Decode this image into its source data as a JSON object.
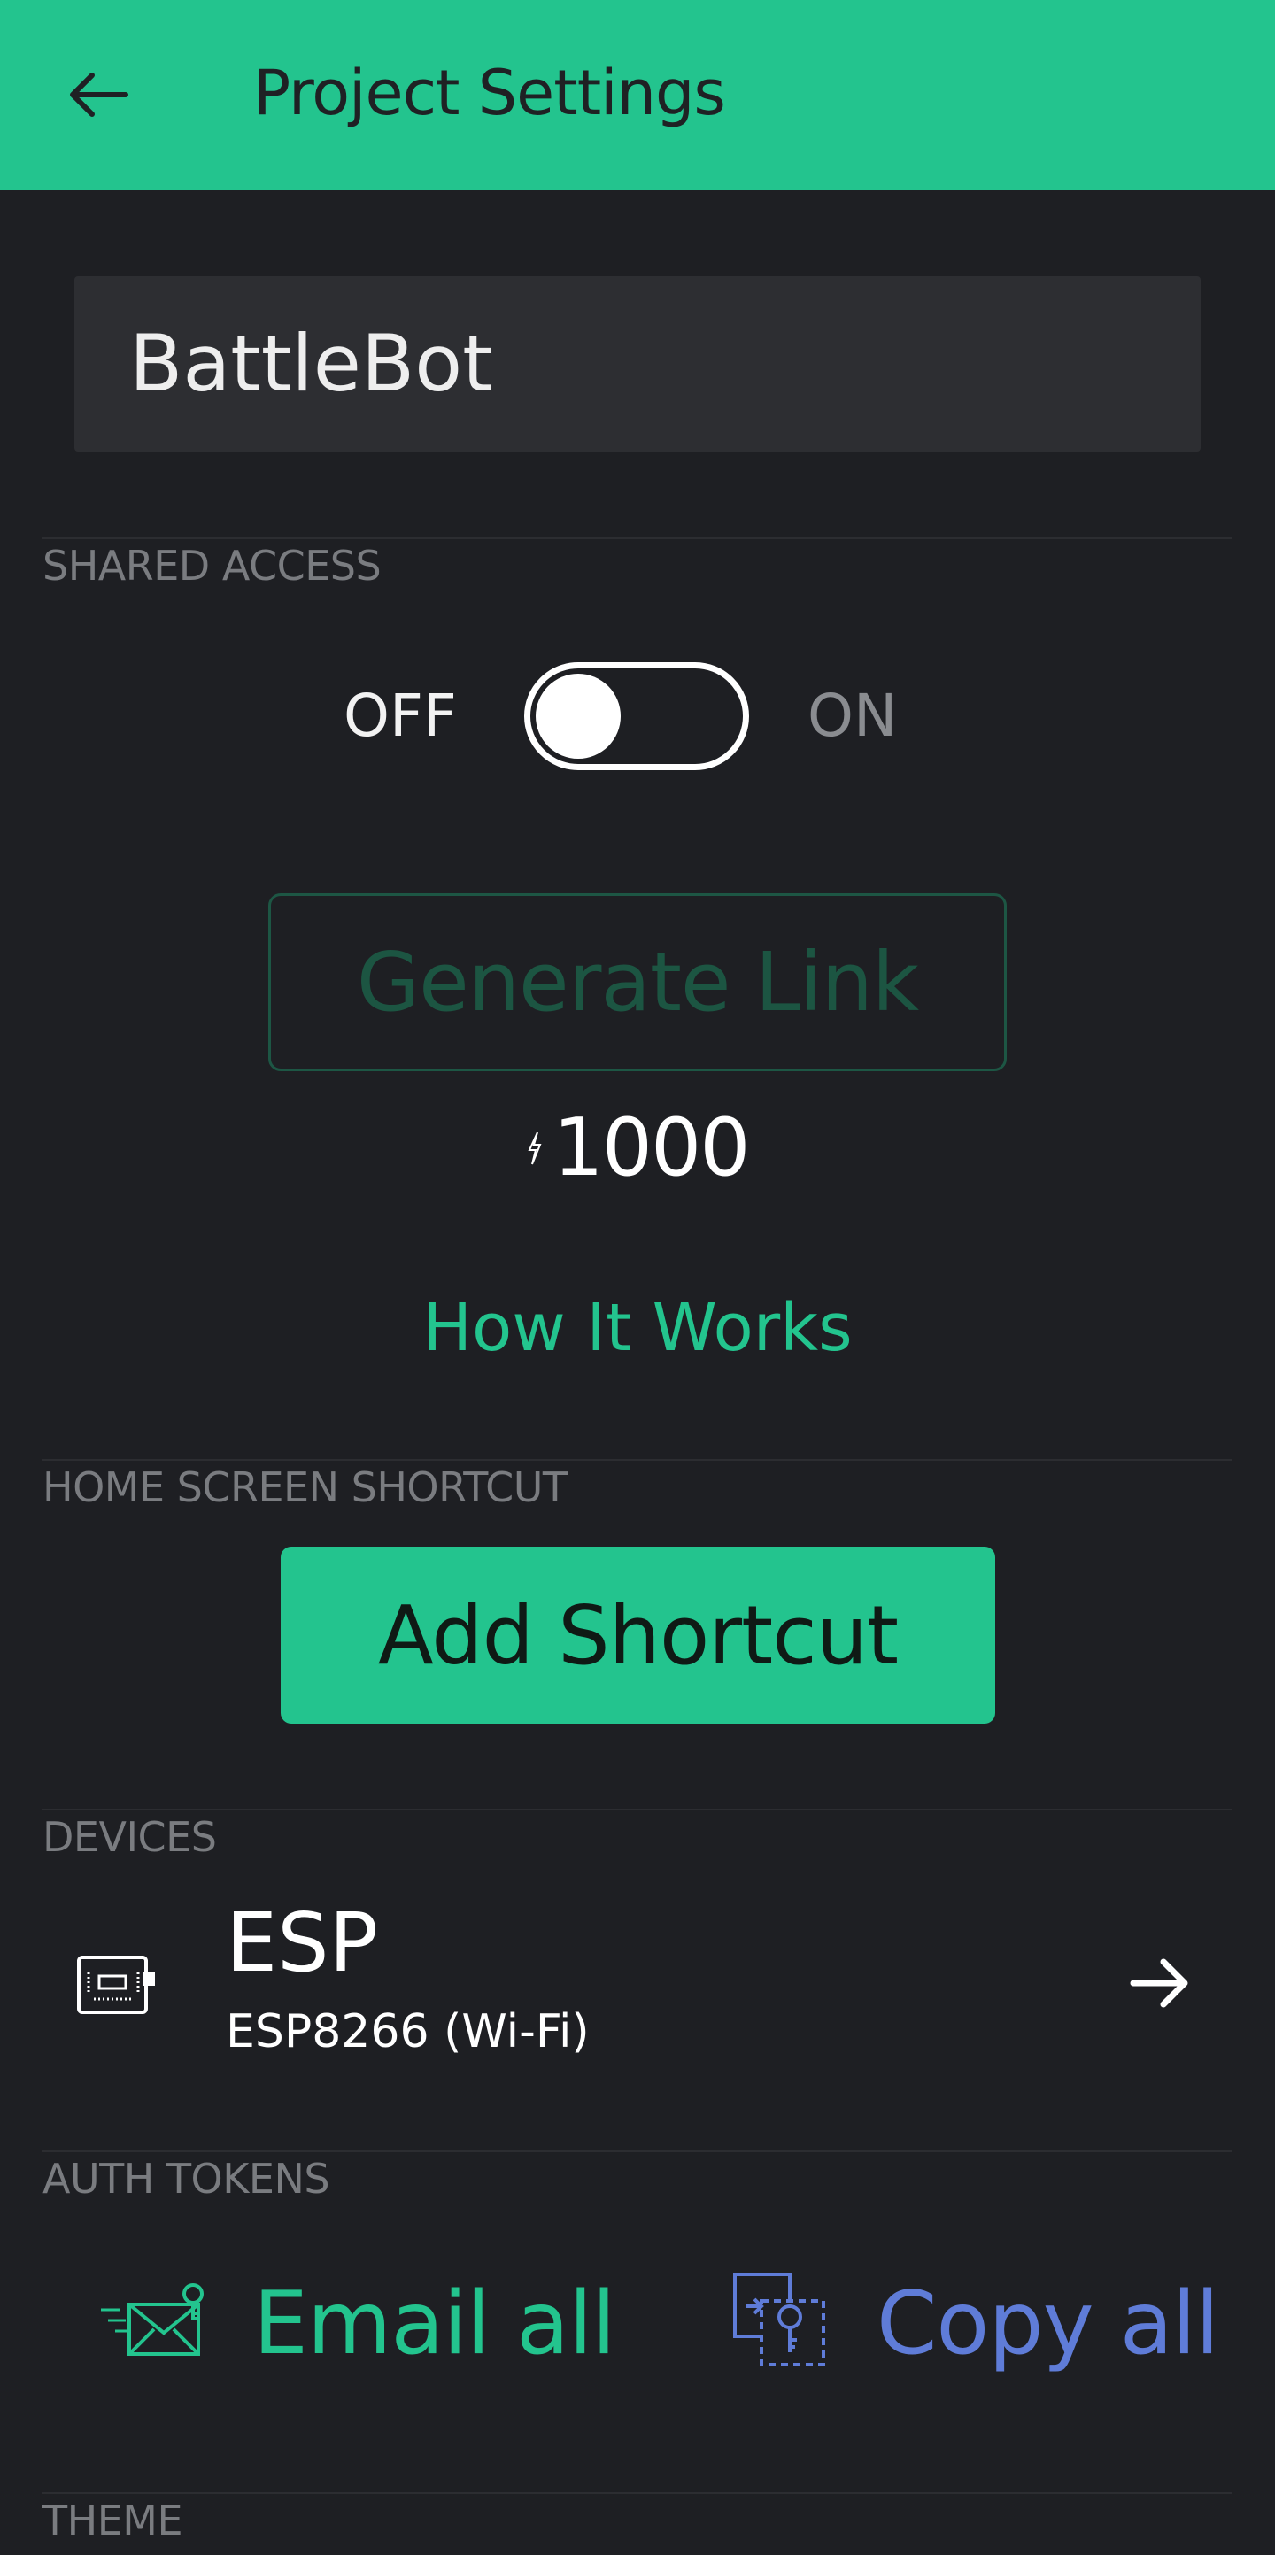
{
  "header": {
    "title": "Project Settings",
    "back_icon": "arrow-left-icon",
    "color": "#23c48e"
  },
  "project": {
    "name": "BattleBot"
  },
  "shared_access": {
    "label": "SHARED ACCESS",
    "off_label": "OFF",
    "on_label": "ON",
    "toggle_state": "off",
    "generate_link_label": "Generate Link",
    "cost_icon": "energy-bolt-icon",
    "cost_value": "1000",
    "how_it_works_label": "How It Works"
  },
  "home_screen_shortcut": {
    "label": "HOME SCREEN SHORTCUT",
    "button_label": "Add Shortcut"
  },
  "devices": {
    "label": "DEVICES",
    "items": [
      {
        "name": "ESP",
        "model": "ESP8266 (Wi-Fi)",
        "icon": "device-board-icon",
        "action_icon": "arrow-right-icon"
      }
    ]
  },
  "auth_tokens": {
    "label": "AUTH TOKENS",
    "email_label": "Email all",
    "email_icon": "email-key-icon",
    "copy_label": "Copy all",
    "copy_icon": "copy-key-icon",
    "email_color": "#23c48e",
    "copy_color": "#5f7cd8"
  },
  "theme": {
    "label": "THEME"
  }
}
